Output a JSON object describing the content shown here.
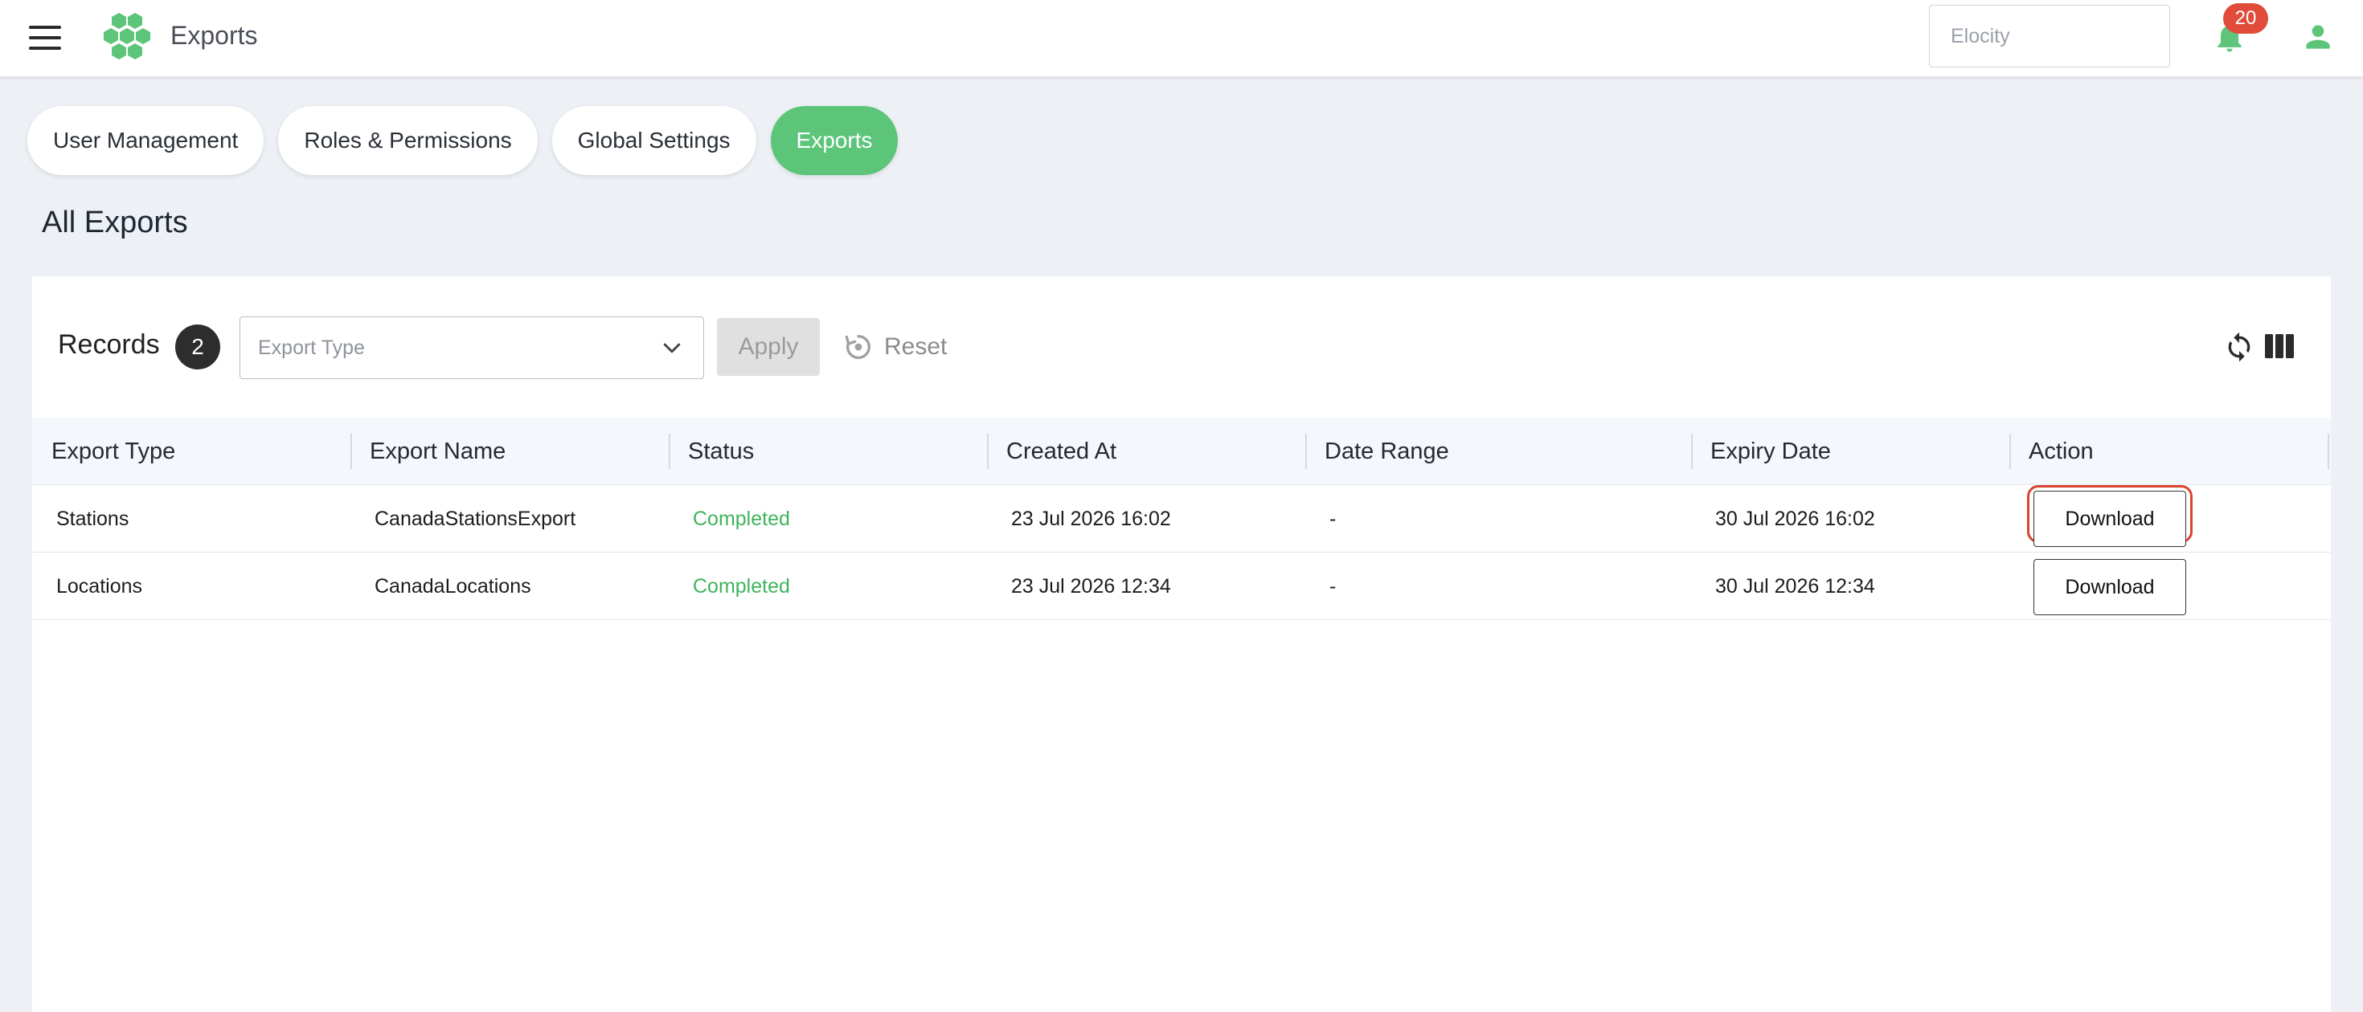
{
  "header": {
    "title": "Exports",
    "org_placeholder": "Elocity",
    "notifications_count": "20",
    "icons": {
      "menu": "hamburger-menu-icon",
      "logo": "hexagon-logo-icon",
      "bell": "bell-icon",
      "user": "user-icon"
    }
  },
  "tabs": [
    {
      "label": "User Management",
      "active": false
    },
    {
      "label": "Roles & Permissions",
      "active": false
    },
    {
      "label": "Global Settings",
      "active": false
    },
    {
      "label": "Exports",
      "active": true
    }
  ],
  "page": {
    "title": "All Exports"
  },
  "toolbar": {
    "records_label": "Records",
    "records_count": "2",
    "export_type_placeholder": "Export Type",
    "apply_label": "Apply",
    "reset_label": "Reset"
  },
  "table": {
    "columns": [
      "Export Type",
      "Export Name",
      "Status",
      "Created At",
      "Date Range",
      "Expiry Date",
      "Action"
    ],
    "rows": [
      {
        "export_type": "Stations",
        "export_name": "CanadaStationsExport",
        "status": "Completed",
        "created_at": "23 Jul 2026 16:02",
        "date_range": "-",
        "expiry_date": "30 Jul 2026 16:02",
        "action": "Download"
      },
      {
        "export_type": "Locations",
        "export_name": "CanadaLocations",
        "status": "Completed",
        "created_at": "23 Jul 2026 12:34",
        "date_range": "-",
        "expiry_date": "30 Jul 2026 12:34",
        "action": "Download"
      }
    ]
  },
  "colors": {
    "accent": "#5cc57a",
    "status_completed": "#3fb45a",
    "badge": "#e04b3a",
    "highlight": "#d9442f"
  }
}
